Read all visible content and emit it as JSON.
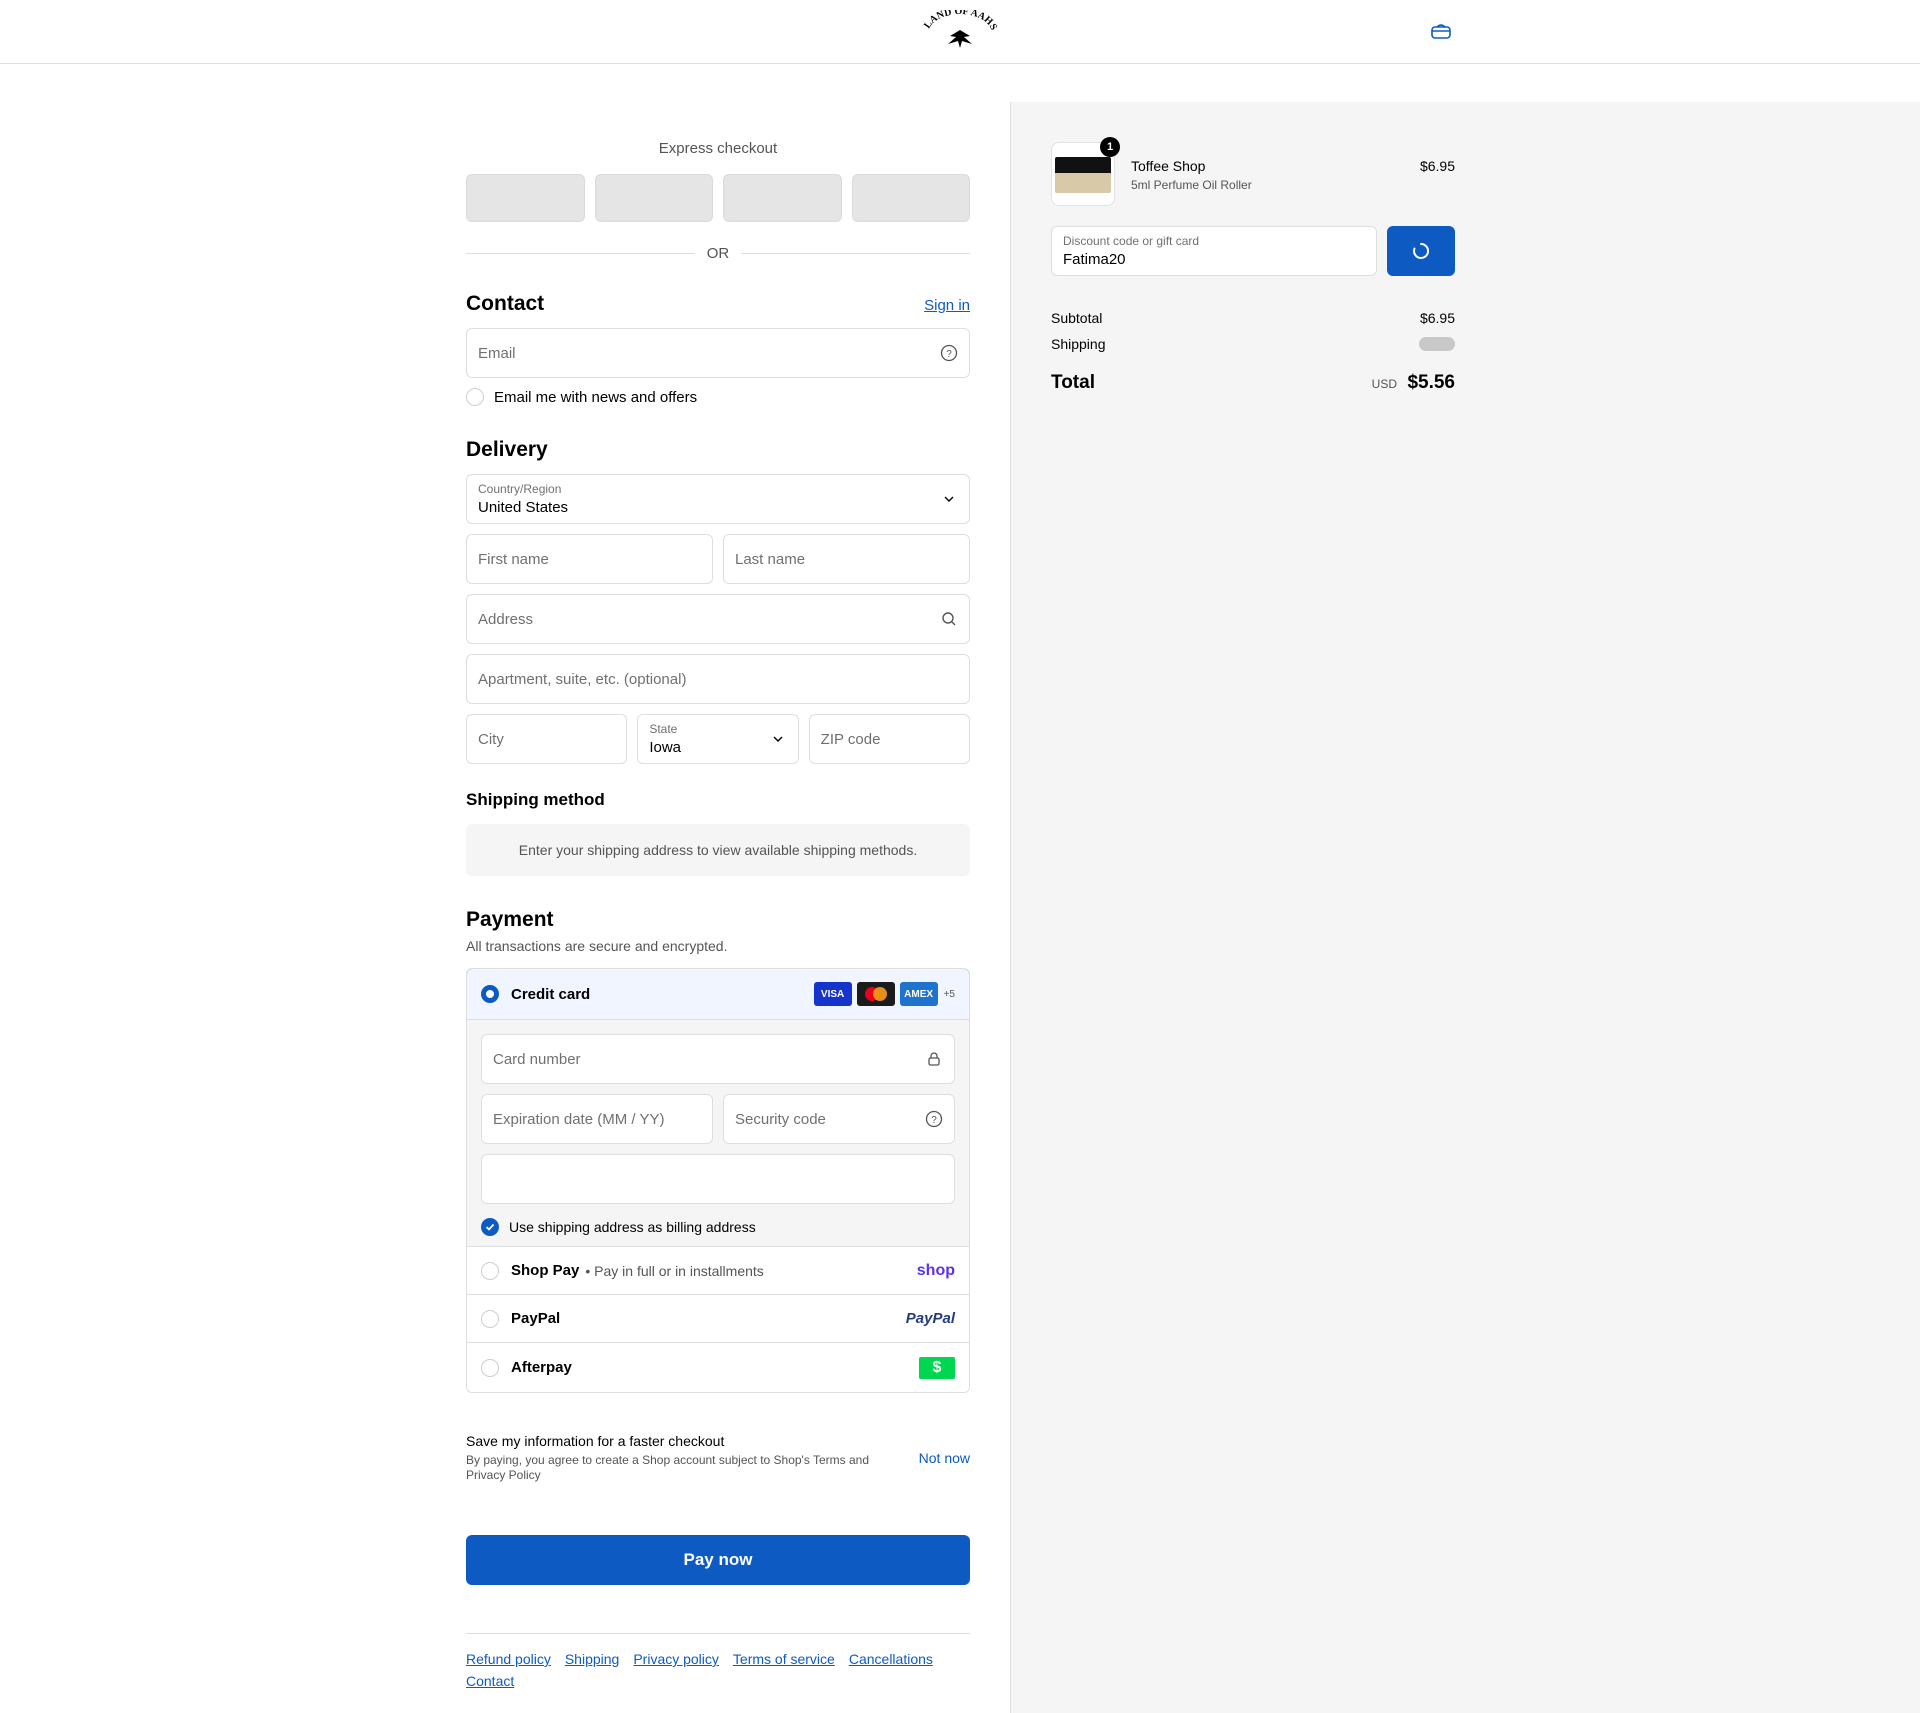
{
  "header": {
    "logo_text": "LAND OF AAHS"
  },
  "express": {
    "title": "Express checkout",
    "or_label": "OR"
  },
  "contact": {
    "title": "Contact",
    "sign_in": "Sign in",
    "email_placeholder": "Email",
    "news_label": "Email me with news and offers"
  },
  "delivery": {
    "title": "Delivery",
    "country_label": "Country/Region",
    "country_value": "United States",
    "first_name": "First name",
    "last_name": "Last name",
    "address": "Address",
    "apartment": "Apartment, suite, etc. (optional)",
    "city": "City",
    "state_label": "State",
    "state_value": "Iowa",
    "zip": "ZIP code"
  },
  "shipping_method": {
    "title": "Shipping method",
    "message": "Enter your shipping address to view available shipping methods."
  },
  "payment": {
    "title": "Payment",
    "subtitle": "All transactions are secure and encrypted.",
    "credit_card": "Credit card",
    "cards": [
      "VISA",
      "MC",
      "AMEX"
    ],
    "more_cards": "+5",
    "card_number": "Card number",
    "expiry": "Expiration date (MM / YY)",
    "security": "Security code",
    "billing_same": "Use shipping address as billing address",
    "shop_pay": "Shop Pay",
    "shop_pay_desc": "• Pay in full or in installments",
    "shop_logo": "shop",
    "paypal": "PayPal",
    "paypal_logo": "PayPal",
    "afterpay": "Afterpay",
    "afterpay_logo": "$"
  },
  "save_info": {
    "title": "Save my information for a faster checkout",
    "text_before": "By paying, you agree to create a Shop account subject to Shop's",
    "terms": "Terms",
    "and": "and",
    "privacy": "Privacy Policy",
    "not_now": "Not now"
  },
  "pay_now": "Pay now",
  "footer": {
    "links": [
      "Refund policy",
      "Shipping",
      "Privacy policy",
      "Terms of service",
      "Cancellations",
      "Contact"
    ]
  },
  "summary": {
    "item": {
      "quantity": "1",
      "name": "Toffee Shop",
      "variant": "5ml Perfume Oil Roller",
      "price": "$6.95"
    },
    "discount_label": "Discount code or gift card",
    "discount_value": "Fatima20",
    "subtotal_label": "Subtotal",
    "subtotal": "$6.95",
    "shipping_label": "Shipping",
    "total_label": "Total",
    "currency": "USD",
    "total": "$5.56"
  },
  "colors": {
    "accent": "#0d5ac3",
    "panel": "#f5f5f5",
    "border": "#dedede"
  }
}
